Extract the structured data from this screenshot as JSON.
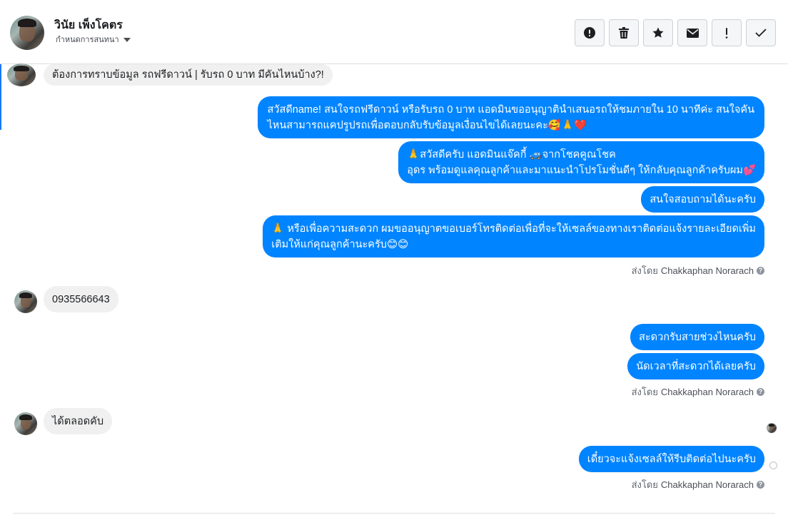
{
  "header": {
    "contact_name": "วินัย เพ็งโคตร",
    "assign_label": "กำหนดการสนทนา",
    "actions": [
      {
        "icon": "alert-circle-icon"
      },
      {
        "icon": "trash-icon"
      },
      {
        "icon": "star-icon"
      },
      {
        "icon": "envelope-icon",
        "label": "✉"
      },
      {
        "icon": "exclamation-icon",
        "label": "!"
      },
      {
        "icon": "checkmark-icon",
        "label": "✓"
      }
    ]
  },
  "messages": [
    {
      "direction": "in",
      "text": "ต้องการทราบข้อมูล รถฟรีดาวน์ | รับรถ 0 บาท มีคันไหนบ้าง?!"
    },
    {
      "direction": "out",
      "lines": [
        "สวัสดีname! สนใจรถฟรีดาวน์ หรือรับรถ 0 บาท แอดมินขออนุญาตินำเสนอรถให้ชมภายใน 10 นาทีค่ะ สนใจคัน",
        "ไหนสามารถแคปรูปรถเพื่อตอบกลับรับข้อมูลเงื่อนไขได้เลยนะคะ🥰🙏❤️"
      ]
    },
    {
      "direction": "out",
      "lines": [
        "🙏สวัสดีครับ แอดมินแจ๊คกี้ 🚙จากโชคคูณโชค",
        "อุดร พร้อมดูแลคุณลูกค้าและมาแนะนำโปรโมชั่นดีๆ ให้กลับคุณลูกค้าครับผม💕"
      ]
    },
    {
      "direction": "out",
      "text": "สนใจสอบถามได้นะครับ"
    },
    {
      "direction": "out",
      "lines": [
        "🙏 หรือเพื่อความสะดวก ผมขออนุญาตขอเบอร์โทรติดต่อเพื่อที่จะให้เซลล์ของทางเราติดต่อแจ้งรายละเอียดเพิ่ม",
        "เติมให้แก่คุณลูกค้านะครับ😊😊"
      ]
    },
    {
      "direction": "in",
      "text": "0935566643"
    },
    {
      "direction": "out",
      "text": "สะดวกรับสายช่วงไหนครับ"
    },
    {
      "direction": "out",
      "text": "นัดเวลาที่สะดวกได้เลยครับ"
    },
    {
      "direction": "in",
      "text": "ได้ตลอดคับ"
    },
    {
      "direction": "out",
      "text": "เดี๋ยวจะแจ้งเซลล์ให้รีบติดต่อไปนะครับ"
    }
  ],
  "sent_by": {
    "prefix": "ส่งโดย",
    "name": "Chakkaphan Norarach",
    "help": "?"
  },
  "colors": {
    "outgoing_bubble": "#0084ff",
    "incoming_bubble": "#f0f0f0",
    "accent": "#1877f2"
  }
}
